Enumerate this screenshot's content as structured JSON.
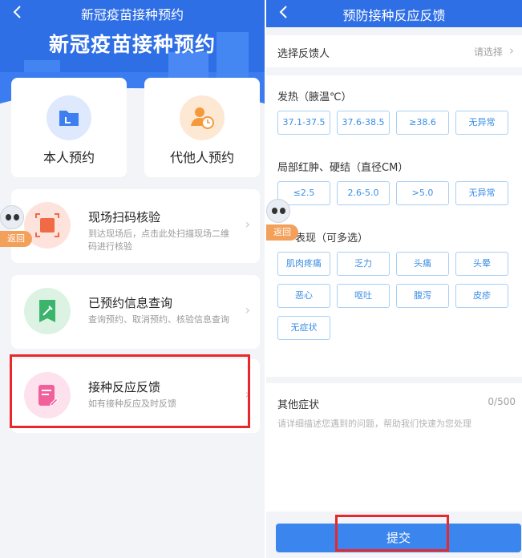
{
  "left": {
    "nav_title": "新冠疫苗接种预约",
    "hero_title": "新冠疫苗接种预约",
    "options": [
      {
        "label": "本人预约",
        "icon": "folder-icon",
        "color": "#3d7ff0"
      },
      {
        "label": "代他人预约",
        "icon": "person-clock-icon",
        "color": "#f59a3a"
      }
    ],
    "rows": [
      {
        "title": "现场扫码核验",
        "desc": "到达现场后，点击此处扫描现场二维码进行核验",
        "icon": "scan-icon",
        "color": "#ef6a45"
      },
      {
        "title": "已预约信息查询",
        "desc": "查询预约、取消预约、核验信息查询",
        "icon": "syringe-icon",
        "color": "#3bb56b"
      },
      {
        "title": "接种反应反馈",
        "desc": "如有接种反应及时反馈",
        "icon": "edit-note-icon",
        "color": "#f0609a"
      }
    ],
    "float_back_label": "返回"
  },
  "right": {
    "nav_title": "预防接种反应反馈",
    "feedback_person": {
      "label": "选择反馈人",
      "value": "请选择"
    },
    "fever": {
      "label": "发热（腋温℃）",
      "options": [
        "37.1-37.5",
        "37.6-38.5",
        "≥38.6",
        "无异常"
      ]
    },
    "local": {
      "label": "局部红肿、硬结（直径CM）",
      "options": [
        "≤2.5",
        "2.6-5.0",
        ">5.0",
        "无异常"
      ]
    },
    "systemic": {
      "label": "全身表现（可多选）",
      "visible_label": "表现（可多选）",
      "options": [
        "肌肉疼痛",
        "乏力",
        "头痛",
        "头晕",
        "恶心",
        "呕吐",
        "腹泻",
        "皮疹",
        "无症状"
      ]
    },
    "other": {
      "label": "其他症状",
      "count": "0/500",
      "placeholder": "请详细描述您遇到的问题，帮助我们快速为您处理"
    },
    "submit_label": "提交",
    "float_back_label": "返回"
  }
}
